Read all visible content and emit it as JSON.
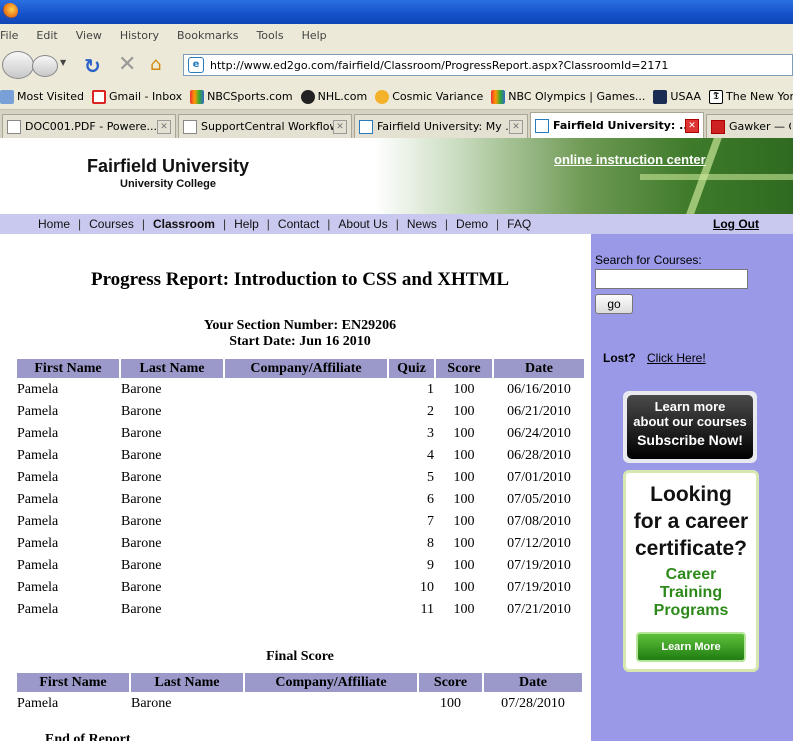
{
  "browser": {
    "menu": [
      "File",
      "Edit",
      "View",
      "History",
      "Bookmarks",
      "Tools",
      "Help"
    ],
    "url": "http://www.ed2go.com/fairfield/Classroom/ProgressReport.aspx?ClassroomId=2171",
    "bookmarks": [
      "Most Visited",
      "Gmail - Inbox",
      "NBCSports.com",
      "NHL.com",
      "Cosmic Variance",
      "NBC Olympics | Games...",
      "USAA",
      "The New York Times - ..."
    ],
    "tabs": [
      {
        "title": "DOC001.PDF - Powere..."
      },
      {
        "title": "SupportCentral Workflow"
      },
      {
        "title": "Fairfield University: My ..."
      },
      {
        "title": "Fairfield University: ..."
      },
      {
        "title": "Gawker — Go"
      }
    ]
  },
  "header": {
    "university": "Fairfield University",
    "college": "University College",
    "tagline": "online instruction center"
  },
  "nav": {
    "items": [
      "Home",
      "Courses",
      "Classroom",
      "Help",
      "Contact",
      "About Us",
      "News",
      "Demo",
      "FAQ"
    ],
    "logout": "Log Out"
  },
  "sidebar": {
    "search_label": "Search for Courses:",
    "search_value": "",
    "go": "go",
    "lost_label": "Lost?",
    "lost_link": "Click Here!",
    "ad1_line1": "Learn more",
    "ad1_line2": "about our courses",
    "ad1_cta": "Subscribe Now!",
    "ad2_line1": "Looking",
    "ad2_line2": "for a career",
    "ad2_line3": "certificate?",
    "ad2_green1": "Career",
    "ad2_green2": "Training",
    "ad2_green3": "Programs",
    "ad2_cta": "Learn More"
  },
  "report": {
    "title": "Progress Report: Introduction to CSS and XHTML",
    "section": "Your Section Number: EN29206",
    "start": "Start Date: Jun 16 2010",
    "headers": [
      "First Name",
      "Last Name",
      "Company/Affiliate",
      "Quiz",
      "Score",
      "Date"
    ],
    "rows": [
      [
        "Pamela",
        "Barone",
        "",
        "1",
        "100",
        "06/16/2010"
      ],
      [
        "Pamela",
        "Barone",
        "",
        "2",
        "100",
        "06/21/2010"
      ],
      [
        "Pamela",
        "Barone",
        "",
        "3",
        "100",
        "06/24/2010"
      ],
      [
        "Pamela",
        "Barone",
        "",
        "4",
        "100",
        "06/28/2010"
      ],
      [
        "Pamela",
        "Barone",
        "",
        "5",
        "100",
        "07/01/2010"
      ],
      [
        "Pamela",
        "Barone",
        "",
        "6",
        "100",
        "07/05/2010"
      ],
      [
        "Pamela",
        "Barone",
        "",
        "7",
        "100",
        "07/08/2010"
      ],
      [
        "Pamela",
        "Barone",
        "",
        "8",
        "100",
        "07/12/2010"
      ],
      [
        "Pamela",
        "Barone",
        "",
        "9",
        "100",
        "07/19/2010"
      ],
      [
        "Pamela",
        "Barone",
        "",
        "10",
        "100",
        "07/19/2010"
      ],
      [
        "Pamela",
        "Barone",
        "",
        "11",
        "100",
        "07/21/2010"
      ]
    ],
    "final_title": "Final Score",
    "final_headers": [
      "First Name",
      "Last Name",
      "Company/Affiliate",
      "Score",
      "Date"
    ],
    "final_rows": [
      [
        "Pamela",
        "Barone",
        "",
        "100",
        "07/28/2010"
      ]
    ],
    "end": "End of Report"
  },
  "colors": {
    "nav_bg": "#c9c8ef",
    "sidebar_bg": "#9a99e8",
    "table_header": "#9a99c9"
  }
}
